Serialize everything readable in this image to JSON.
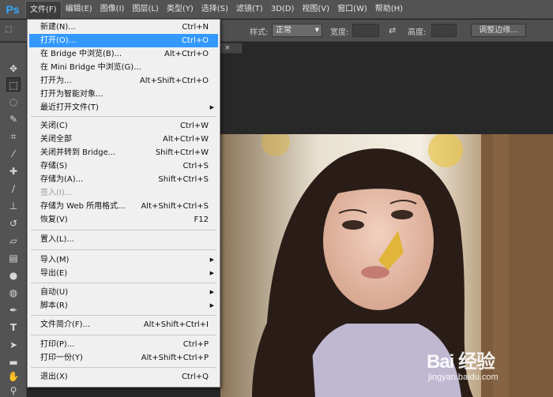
{
  "app": {
    "logo": "Ps"
  },
  "menubar": {
    "items": [
      "文件(F)",
      "编辑(E)",
      "图像(I)",
      "图层(L)",
      "类型(Y)",
      "选择(S)",
      "滤镜(T)",
      "3D(D)",
      "视图(V)",
      "窗口(W)",
      "帮助(H)"
    ]
  },
  "options": {
    "style_label": "样式:",
    "style_value": "正常",
    "width_label": "宽度:",
    "height_label": "高度:",
    "refine_edge": "调整边缘..."
  },
  "file_menu": {
    "items": [
      {
        "label": "新建(N)...",
        "shortcut": "Ctrl+N"
      },
      {
        "label": "打开(O)...",
        "shortcut": "Ctrl+O"
      },
      {
        "label": "在 Bridge 中浏览(B)...",
        "shortcut": "Alt+Ctrl+O"
      },
      {
        "label": "在 Mini Bridge 中浏览(G)...",
        "shortcut": ""
      },
      {
        "label": "打开为...",
        "shortcut": "Alt+Shift+Ctrl+O"
      },
      {
        "label": "打开为智能对象...",
        "shortcut": ""
      },
      {
        "label": "最近打开文件(T)",
        "shortcut": ""
      },
      {
        "label": "关闭(C)",
        "shortcut": "Ctrl+W"
      },
      {
        "label": "关闭全部",
        "shortcut": "Alt+Ctrl+W"
      },
      {
        "label": "关闭并转到 Bridge...",
        "shortcut": "Shift+Ctrl+W"
      },
      {
        "label": "存储(S)",
        "shortcut": "Ctrl+S"
      },
      {
        "label": "存储为(A)...",
        "shortcut": "Shift+Ctrl+S"
      },
      {
        "label": "签入(I)...",
        "shortcut": ""
      },
      {
        "label": "存储为 Web 所用格式...",
        "shortcut": "Alt+Shift+Ctrl+S"
      },
      {
        "label": "恢复(V)",
        "shortcut": "F12"
      },
      {
        "label": "置入(L)...",
        "shortcut": ""
      },
      {
        "label": "导入(M)",
        "shortcut": ""
      },
      {
        "label": "导出(E)",
        "shortcut": ""
      },
      {
        "label": "自动(U)",
        "shortcut": ""
      },
      {
        "label": "脚本(R)",
        "shortcut": ""
      },
      {
        "label": "文件简介(F)...",
        "shortcut": "Alt+Shift+Ctrl+I"
      },
      {
        "label": "打印(P)...",
        "shortcut": "Ctrl+P"
      },
      {
        "label": "打印一份(Y)",
        "shortcut": "Alt+Shift+Ctrl+P"
      },
      {
        "label": "退出(X)",
        "shortcut": "Ctrl+Q"
      }
    ]
  },
  "document": {
    "close_glyph": "×"
  },
  "watermark": {
    "brand": "Bai 经验",
    "url": "jingyan.baidu.com"
  },
  "colors": {
    "highlight": "#3399ff",
    "menu_bg": "#f0f0f0",
    "ui_dark": "#535353",
    "logo": "#31a8ff"
  }
}
